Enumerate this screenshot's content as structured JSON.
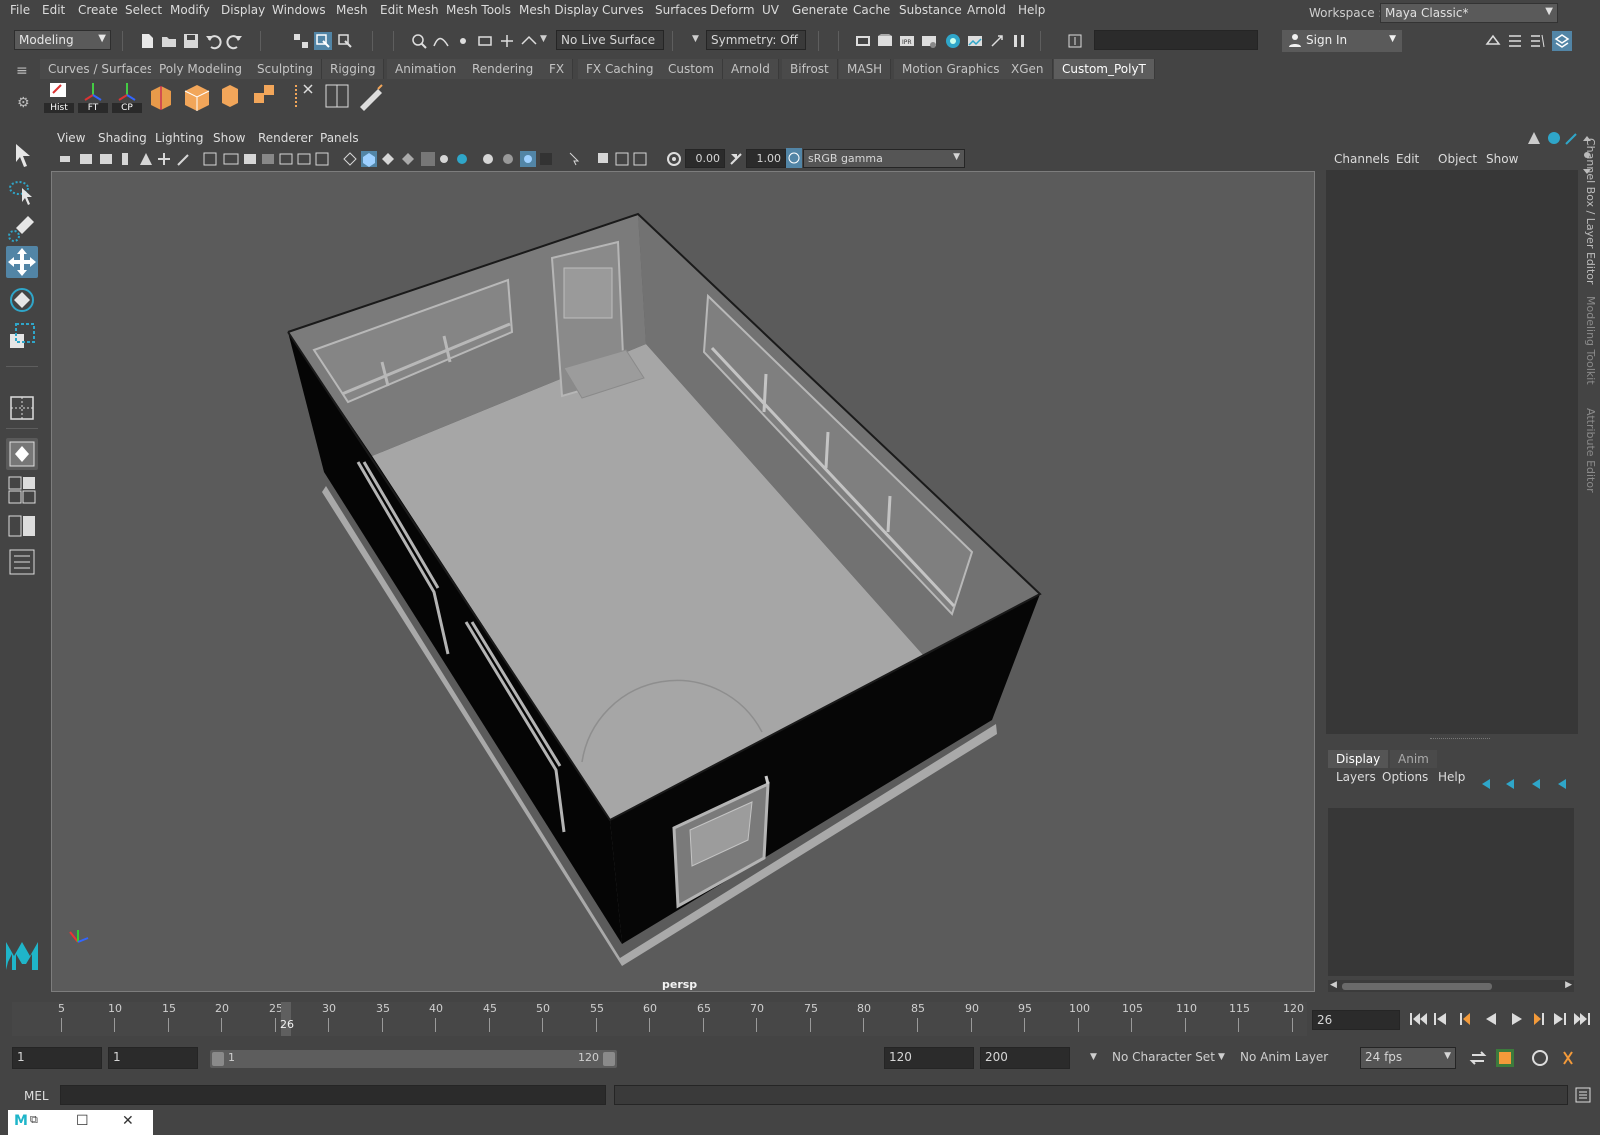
{
  "menu": [
    "File",
    "Edit",
    "Create",
    "Select",
    "Modify",
    "Display",
    "Windows",
    "Mesh",
    "Edit Mesh",
    "Mesh Tools",
    "Mesh Display",
    "Curves",
    "Surfaces",
    "Deform",
    "UV",
    "Generate",
    "Cache",
    "Substance",
    "Arnold",
    "Help"
  ],
  "workspace": {
    "label": "Workspace :",
    "value": "Maya Classic*"
  },
  "status": {
    "mode": "Modeling",
    "live_surface": "No Live Surface",
    "symmetry": "Symmetry: Off",
    "sign_in": "Sign In"
  },
  "shelf": {
    "tabs": [
      "Curves / Surfaces",
      "Poly Modeling",
      "Sculpting",
      "Rigging",
      "Animation",
      "Rendering",
      "FX",
      "FX Caching",
      "Custom",
      "Arnold",
      "Bifrost",
      "MASH",
      "Motion Graphics",
      "XGen",
      "Custom_PolyT"
    ],
    "active_tab": "Custom_PolyT",
    "buttons": [
      "Hist",
      "FT",
      "CP"
    ]
  },
  "panel": {
    "menu": [
      "View",
      "Shading",
      "Lighting",
      "Show",
      "Renderer",
      "Panels"
    ],
    "exposure": "0.00",
    "gamma": "1.00",
    "color_space": "sRGB gamma",
    "camera": "persp"
  },
  "channel_box": {
    "menu": [
      "Channels",
      "Edit",
      "Object",
      "Show"
    ],
    "vertical_tabs": [
      "Channel Box / Layer Editor",
      "Modeling Toolkit",
      "Attribute Editor"
    ]
  },
  "layer_editor": {
    "tabs": [
      "Display",
      "Anim"
    ],
    "active_tab": "Display",
    "menu": [
      "Layers",
      "Options",
      "Help"
    ]
  },
  "timeline": {
    "ticks": [
      "5",
      "10",
      "15",
      "20",
      "25",
      "30",
      "35",
      "40",
      "45",
      "50",
      "55",
      "60",
      "65",
      "70",
      "75",
      "80",
      "85",
      "90",
      "95",
      "100",
      "105",
      "110",
      "115",
      "120"
    ],
    "current_frame": "26",
    "current_frame_field": "26"
  },
  "range": {
    "start": "1",
    "playback_start": "1",
    "range_start_label": "1",
    "range_end_label": "120",
    "playback_end": "120",
    "end": "200",
    "character_set": "No Character Set",
    "anim_layer": "No Anim Layer",
    "fps": "24 fps"
  },
  "command_line": {
    "label": "MEL"
  },
  "colors": {
    "accent": "#5285a6",
    "bg": "#444444",
    "viewport": "#5b5b5b"
  }
}
